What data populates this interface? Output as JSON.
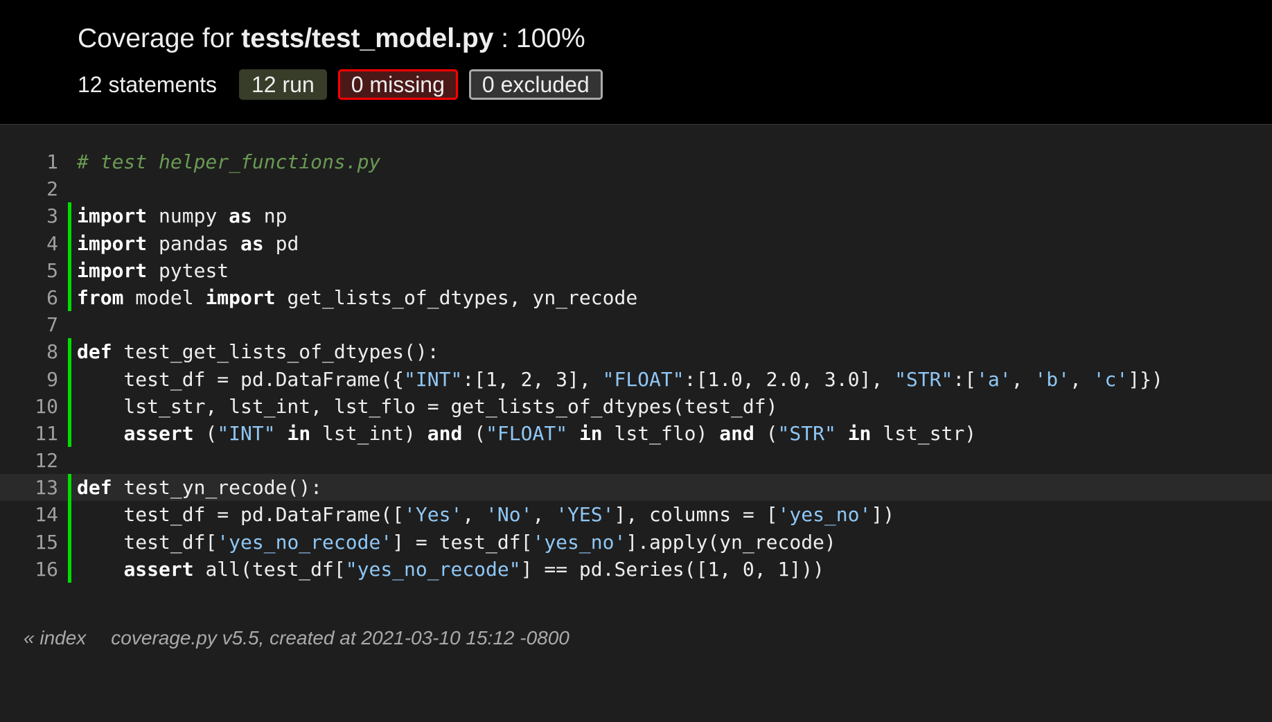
{
  "header": {
    "title_prefix": "Coverage for ",
    "filename": "tests/test_model.py",
    "title_suffix": " : 100%",
    "statements": "12 statements",
    "run": "12 run",
    "missing": "0 missing",
    "excluded": "0 excluded"
  },
  "colors": {
    "run_marker": "#00dd00",
    "missing_border": "#ff0000",
    "string": "#8fc7f5",
    "comment": "#6a9a53"
  },
  "source": [
    {
      "n": "1",
      "run": false,
      "hl": false,
      "tokens": [
        {
          "t": "com",
          "v": "# test helper_functions.py"
        }
      ]
    },
    {
      "n": "2",
      "run": false,
      "hl": false,
      "tokens": []
    },
    {
      "n": "3",
      "run": true,
      "hl": false,
      "tokens": [
        {
          "t": "kw",
          "v": "import"
        },
        {
          "t": "txt",
          "v": " numpy "
        },
        {
          "t": "kw",
          "v": "as"
        },
        {
          "t": "txt",
          "v": " np"
        }
      ]
    },
    {
      "n": "4",
      "run": true,
      "hl": false,
      "tokens": [
        {
          "t": "kw",
          "v": "import"
        },
        {
          "t": "txt",
          "v": " pandas "
        },
        {
          "t": "kw",
          "v": "as"
        },
        {
          "t": "txt",
          "v": " pd"
        }
      ]
    },
    {
      "n": "5",
      "run": true,
      "hl": false,
      "tokens": [
        {
          "t": "kw",
          "v": "import"
        },
        {
          "t": "txt",
          "v": " pytest"
        }
      ]
    },
    {
      "n": "6",
      "run": true,
      "hl": false,
      "tokens": [
        {
          "t": "kw",
          "v": "from"
        },
        {
          "t": "txt",
          "v": " model "
        },
        {
          "t": "kw",
          "v": "import"
        },
        {
          "t": "txt",
          "v": " get_lists_of_dtypes, yn_recode"
        }
      ]
    },
    {
      "n": "7",
      "run": false,
      "hl": false,
      "tokens": []
    },
    {
      "n": "8",
      "run": true,
      "hl": false,
      "tokens": [
        {
          "t": "kw",
          "v": "def"
        },
        {
          "t": "txt",
          "v": " test_get_lists_of_dtypes():"
        }
      ]
    },
    {
      "n": "9",
      "run": true,
      "hl": false,
      "tokens": [
        {
          "t": "txt",
          "v": "    test_df = pd.DataFrame({"
        },
        {
          "t": "str",
          "v": "\"INT\""
        },
        {
          "t": "txt",
          "v": ":[1, 2, 3], "
        },
        {
          "t": "str",
          "v": "\"FLOAT\""
        },
        {
          "t": "txt",
          "v": ":[1.0, 2.0, 3.0], "
        },
        {
          "t": "str",
          "v": "\"STR\""
        },
        {
          "t": "txt",
          "v": ":["
        },
        {
          "t": "str",
          "v": "'a'"
        },
        {
          "t": "txt",
          "v": ", "
        },
        {
          "t": "str",
          "v": "'b'"
        },
        {
          "t": "txt",
          "v": ", "
        },
        {
          "t": "str",
          "v": "'c'"
        },
        {
          "t": "txt",
          "v": "]})"
        }
      ]
    },
    {
      "n": "10",
      "run": true,
      "hl": false,
      "tokens": [
        {
          "t": "txt",
          "v": "    lst_str, lst_int, lst_flo = get_lists_of_dtypes(test_df)"
        }
      ]
    },
    {
      "n": "11",
      "run": true,
      "hl": false,
      "tokens": [
        {
          "t": "txt",
          "v": "    "
        },
        {
          "t": "kw",
          "v": "assert"
        },
        {
          "t": "txt",
          "v": " ("
        },
        {
          "t": "str",
          "v": "\"INT\""
        },
        {
          "t": "txt",
          "v": " "
        },
        {
          "t": "kw",
          "v": "in"
        },
        {
          "t": "txt",
          "v": " lst_int) "
        },
        {
          "t": "kw",
          "v": "and"
        },
        {
          "t": "txt",
          "v": " ("
        },
        {
          "t": "str",
          "v": "\"FLOAT\""
        },
        {
          "t": "txt",
          "v": " "
        },
        {
          "t": "kw",
          "v": "in"
        },
        {
          "t": "txt",
          "v": " lst_flo) "
        },
        {
          "t": "kw",
          "v": "and"
        },
        {
          "t": "txt",
          "v": " ("
        },
        {
          "t": "str",
          "v": "\"STR\""
        },
        {
          "t": "txt",
          "v": " "
        },
        {
          "t": "kw",
          "v": "in"
        },
        {
          "t": "txt",
          "v": " lst_str)"
        }
      ]
    },
    {
      "n": "12",
      "run": false,
      "hl": false,
      "tokens": []
    },
    {
      "n": "13",
      "run": true,
      "hl": true,
      "tokens": [
        {
          "t": "kw",
          "v": "def"
        },
        {
          "t": "txt",
          "v": " test_yn_recode():"
        }
      ]
    },
    {
      "n": "14",
      "run": true,
      "hl": false,
      "tokens": [
        {
          "t": "txt",
          "v": "    test_df = pd.DataFrame(["
        },
        {
          "t": "str",
          "v": "'Yes'"
        },
        {
          "t": "txt",
          "v": ", "
        },
        {
          "t": "str",
          "v": "'No'"
        },
        {
          "t": "txt",
          "v": ", "
        },
        {
          "t": "str",
          "v": "'YES'"
        },
        {
          "t": "txt",
          "v": "], columns = ["
        },
        {
          "t": "str",
          "v": "'yes_no'"
        },
        {
          "t": "txt",
          "v": "])"
        }
      ]
    },
    {
      "n": "15",
      "run": true,
      "hl": false,
      "tokens": [
        {
          "t": "txt",
          "v": "    test_df["
        },
        {
          "t": "str",
          "v": "'yes_no_recode'"
        },
        {
          "t": "txt",
          "v": "] = test_df["
        },
        {
          "t": "str",
          "v": "'yes_no'"
        },
        {
          "t": "txt",
          "v": "].apply(yn_recode)"
        }
      ]
    },
    {
      "n": "16",
      "run": true,
      "hl": false,
      "tokens": [
        {
          "t": "txt",
          "v": "    "
        },
        {
          "t": "kw",
          "v": "assert"
        },
        {
          "t": "txt",
          "v": " all(test_df["
        },
        {
          "t": "str",
          "v": "\"yes_no_recode\""
        },
        {
          "t": "txt",
          "v": "] == pd.Series([1, 0, 1]))"
        }
      ]
    }
  ],
  "footer": {
    "index_link": "« index",
    "created": "coverage.py v5.5, created at 2021-03-10 15:12 -0800"
  }
}
